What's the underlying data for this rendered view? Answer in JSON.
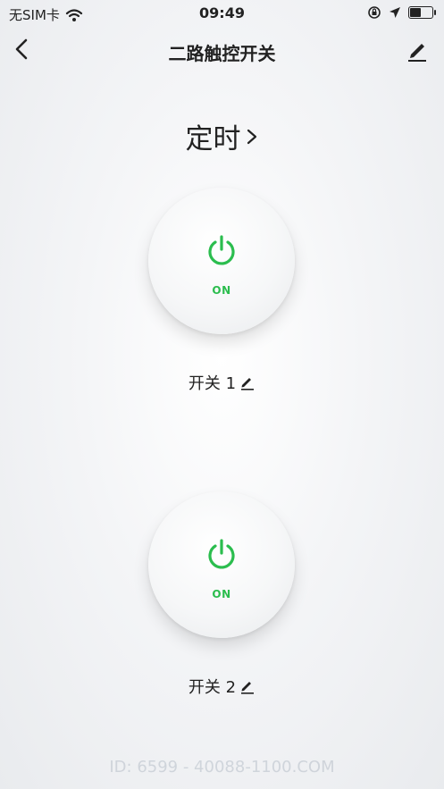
{
  "status_bar": {
    "carrier": "无SIM卡",
    "time": "09:49",
    "battery_level": 0.5
  },
  "nav": {
    "title": "二路触控开关"
  },
  "timer": {
    "label": "定时",
    "chevron": "chevron-right-icon"
  },
  "switches": [
    {
      "name": "开关 1",
      "state_label": "ON",
      "icon": "power-icon"
    },
    {
      "name": "开关 2",
      "state_label": "ON",
      "icon": "power-icon"
    }
  ],
  "colors": {
    "on": "#2bbd4e",
    "text": "#222222"
  },
  "watermark": "ID: 6599 - 40088-1100.COM"
}
